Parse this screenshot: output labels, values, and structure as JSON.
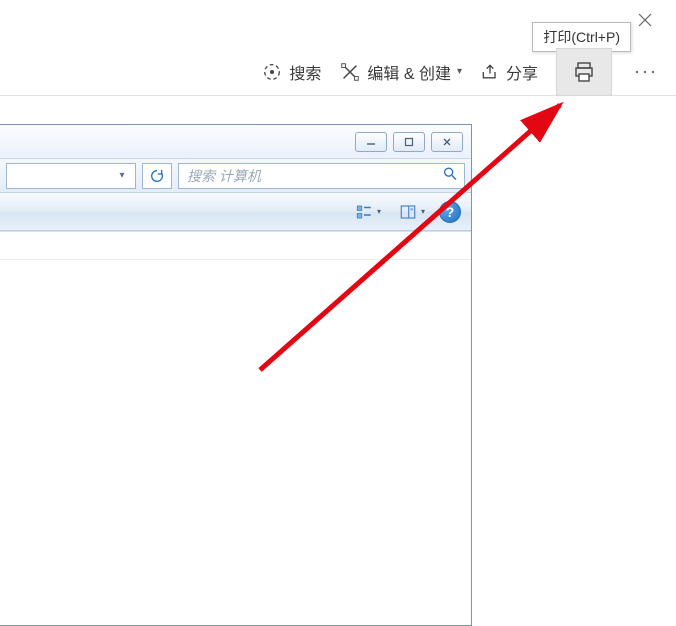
{
  "titlebar": {
    "close_glyph": "✕"
  },
  "tooltip": {
    "text": "打印(Ctrl+P)"
  },
  "toolbar": {
    "search_label": "搜索",
    "edit_label": "编辑 & 创建",
    "share_label": "分享",
    "more_glyph": "···"
  },
  "explorer": {
    "caption": {
      "min_glyph": "—",
      "max_glyph": "▢",
      "close_glyph": "✕"
    },
    "address": {
      "dropdown_glyph": "▾",
      "refresh_glyph": "↻"
    },
    "search": {
      "placeholder": "搜索 计算机"
    },
    "cmd": {
      "view_dd_glyph": "▾",
      "help_glyph": "?"
    }
  }
}
